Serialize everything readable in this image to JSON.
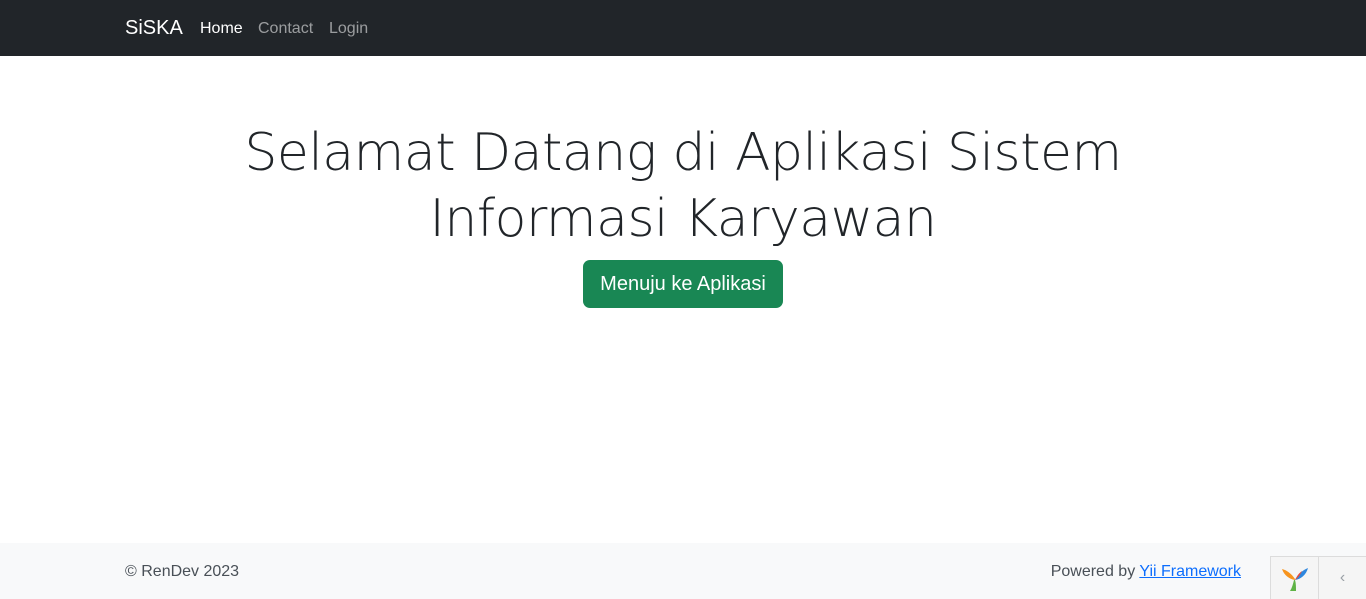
{
  "navbar": {
    "brand": "SiSKA",
    "links": [
      {
        "label": "Home",
        "active": true
      },
      {
        "label": "Contact",
        "active": false
      },
      {
        "label": "Login",
        "active": false
      }
    ]
  },
  "hero": {
    "title": "Selamat Datang di Aplikasi Sistem Informasi Karyawan",
    "button_label": "Menuju ke Aplikasi"
  },
  "footer": {
    "copyright": "© RenDev 2023",
    "powered_prefix": "Powered by ",
    "powered_link": "Yii Framework"
  },
  "debug_toolbar": {
    "logo_icon": "yii-logo-icon",
    "toggle_icon": "chevron-left-icon",
    "toggle_glyph": "‹"
  },
  "colors": {
    "navbar_bg": "#212529",
    "button_bg": "#198754",
    "footer_bg": "#f8f9fa",
    "link": "#0d6efd"
  }
}
